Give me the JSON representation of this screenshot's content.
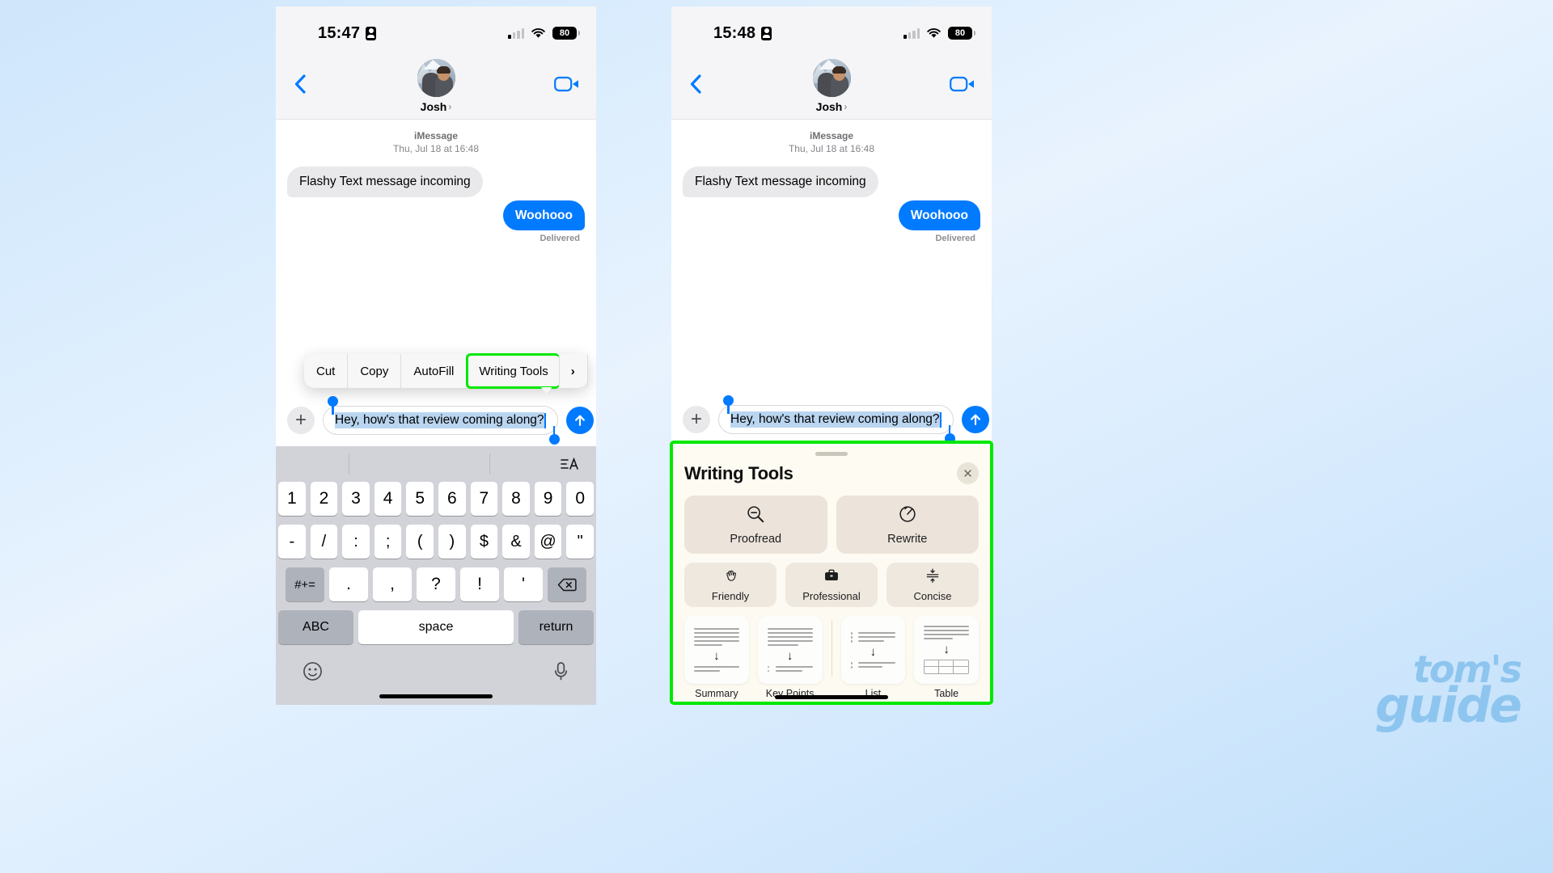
{
  "background": {
    "accent": "#8dc5ef",
    "highlight": "#00e800",
    "imessage_blue": "#007aff"
  },
  "watermark": {
    "line1": "tom's",
    "line2": "guide"
  },
  "phone_left": {
    "status": {
      "time": "15:47",
      "signal_icon": "cellular-bars-icon",
      "wifi_icon": "wifi-icon",
      "battery_level": "80",
      "recording_icon": "screen-record-icon"
    },
    "nav": {
      "back_icon": "chevron-left-icon",
      "contact_name": "Josh",
      "disclosure_icon": "chevron-right-icon",
      "facetime_icon": "video-camera-icon",
      "avatar": "contact-avatar"
    },
    "thread": {
      "service": "iMessage",
      "timestamp": "Thu, Jul 18 at 16:48",
      "messages": [
        {
          "text": "Flashy Text message incoming",
          "direction": "incoming"
        },
        {
          "text": "Woohooo",
          "direction": "outgoing"
        }
      ],
      "delivery_status": "Delivered"
    },
    "context_menu": {
      "items": [
        "Cut",
        "Copy",
        "AutoFill",
        "Writing Tools"
      ],
      "highlighted": "Writing Tools",
      "more_icon": "chevron-right-icon"
    },
    "composer": {
      "add_icon": "plus-icon",
      "text": "Hey, how's that review coming along?",
      "send_icon": "arrow-up-circle-icon",
      "selection_handles": "text-selection-handles"
    },
    "keyboard": {
      "format_icon": "text-format-icon",
      "row_numbers": [
        "1",
        "2",
        "3",
        "4",
        "5",
        "6",
        "7",
        "8",
        "9",
        "0"
      ],
      "row_symbols": [
        "-",
        "/",
        ":",
        ";",
        "(",
        ")",
        "$",
        "&",
        "@",
        "\""
      ],
      "row_more": [
        "#+=",
        ".",
        ",",
        "?",
        "!",
        "'"
      ],
      "backspace_icon": "delete-backward-icon",
      "row_bottom": {
        "abc": "ABC",
        "space": "space",
        "return": "return"
      },
      "emoji_icon": "emoji-smiley-icon",
      "mic_icon": "microphone-icon"
    }
  },
  "phone_right": {
    "status": {
      "time": "15:48",
      "signal_icon": "cellular-bars-icon",
      "wifi_icon": "wifi-icon",
      "battery_level": "80",
      "recording_icon": "screen-record-icon"
    },
    "nav": {
      "back_icon": "chevron-left-icon",
      "contact_name": "Josh",
      "disclosure_icon": "chevron-right-icon",
      "facetime_icon": "video-camera-icon",
      "avatar": "contact-avatar"
    },
    "thread": {
      "service": "iMessage",
      "timestamp": "Thu, Jul 18 at 16:48",
      "messages": [
        {
          "text": "Flashy Text message incoming",
          "direction": "incoming"
        },
        {
          "text": "Woohooo",
          "direction": "outgoing"
        }
      ],
      "delivery_status": "Delivered"
    },
    "composer": {
      "add_icon": "plus-icon",
      "text": "Hey, how's that review coming along?",
      "send_icon": "arrow-up-circle-icon",
      "selection_handles": "text-selection-handles"
    },
    "writing_tools": {
      "title": "Writing Tools",
      "close_icon": "close-x-icon",
      "grabber": "sheet-grabber",
      "primary": [
        {
          "label": "Proofread",
          "icon": "magnifier-minus-icon"
        },
        {
          "label": "Rewrite",
          "icon": "rewrite-circle-icon"
        }
      ],
      "tones": [
        {
          "label": "Friendly",
          "icon": "waving-hand-icon"
        },
        {
          "label": "Professional",
          "icon": "briefcase-icon"
        },
        {
          "label": "Concise",
          "icon": "compress-lines-icon"
        }
      ],
      "transforms": [
        {
          "label": "Summary",
          "icon": "summary-card-icon"
        },
        {
          "label": "Key Points",
          "icon": "key-points-card-icon"
        },
        {
          "label": "List",
          "icon": "list-card-icon"
        },
        {
          "label": "Table",
          "icon": "table-card-icon"
        }
      ]
    }
  }
}
